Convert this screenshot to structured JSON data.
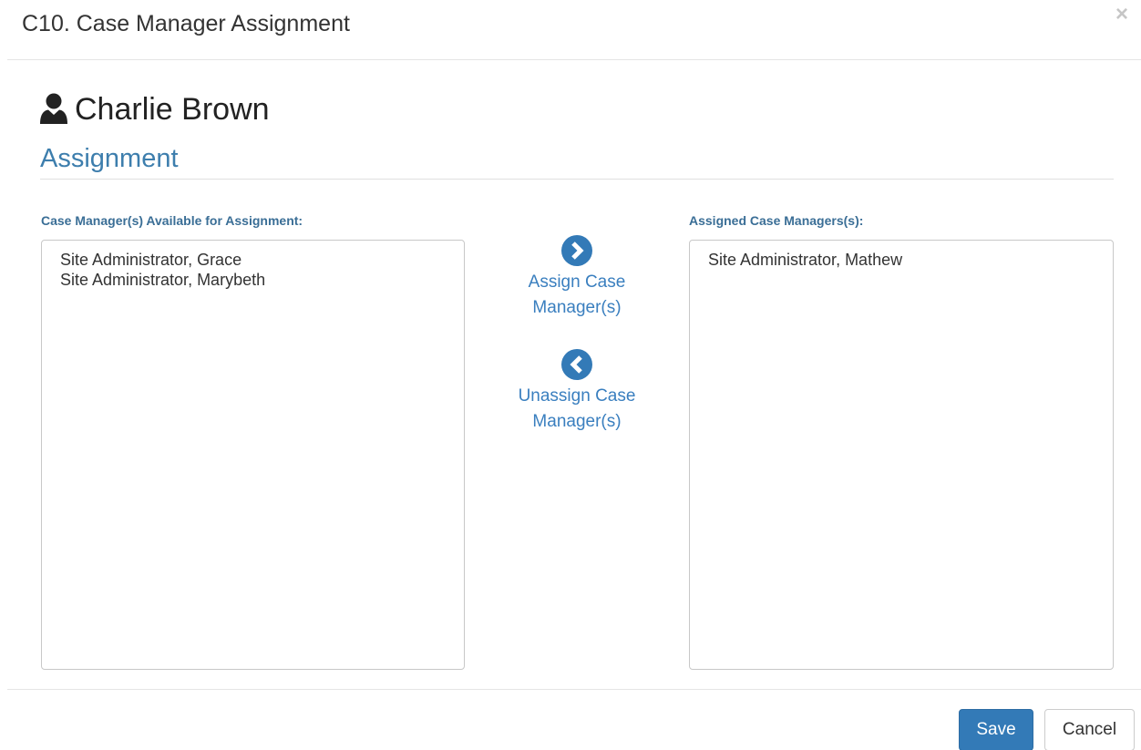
{
  "modal": {
    "title": "C10. Case Manager Assignment",
    "close_symbol": "×"
  },
  "patient": {
    "name": "Charlie Brown",
    "icon": "user-icon"
  },
  "section": {
    "title": "Assignment"
  },
  "available": {
    "label": "Case Manager(s) Available for Assignment:",
    "items": [
      "Site Administrator, Grace",
      "Site Administrator, Marybeth"
    ]
  },
  "assigned": {
    "label": "Assigned Case Managers(s):",
    "items": [
      "Site Administrator, Mathew"
    ]
  },
  "actions": {
    "assign_label": "Assign Case Manager(s)",
    "assign_icon": "chevron-right-circle-icon",
    "unassign_label": "Unassign Case Manager(s)",
    "unassign_icon": "chevron-left-circle-icon"
  },
  "footer": {
    "save_label": "Save",
    "cancel_label": "Cancel"
  },
  "colors": {
    "accent": "#3a7fbf",
    "section_title": "#3d7ead",
    "primary_button": "#337ab7"
  }
}
